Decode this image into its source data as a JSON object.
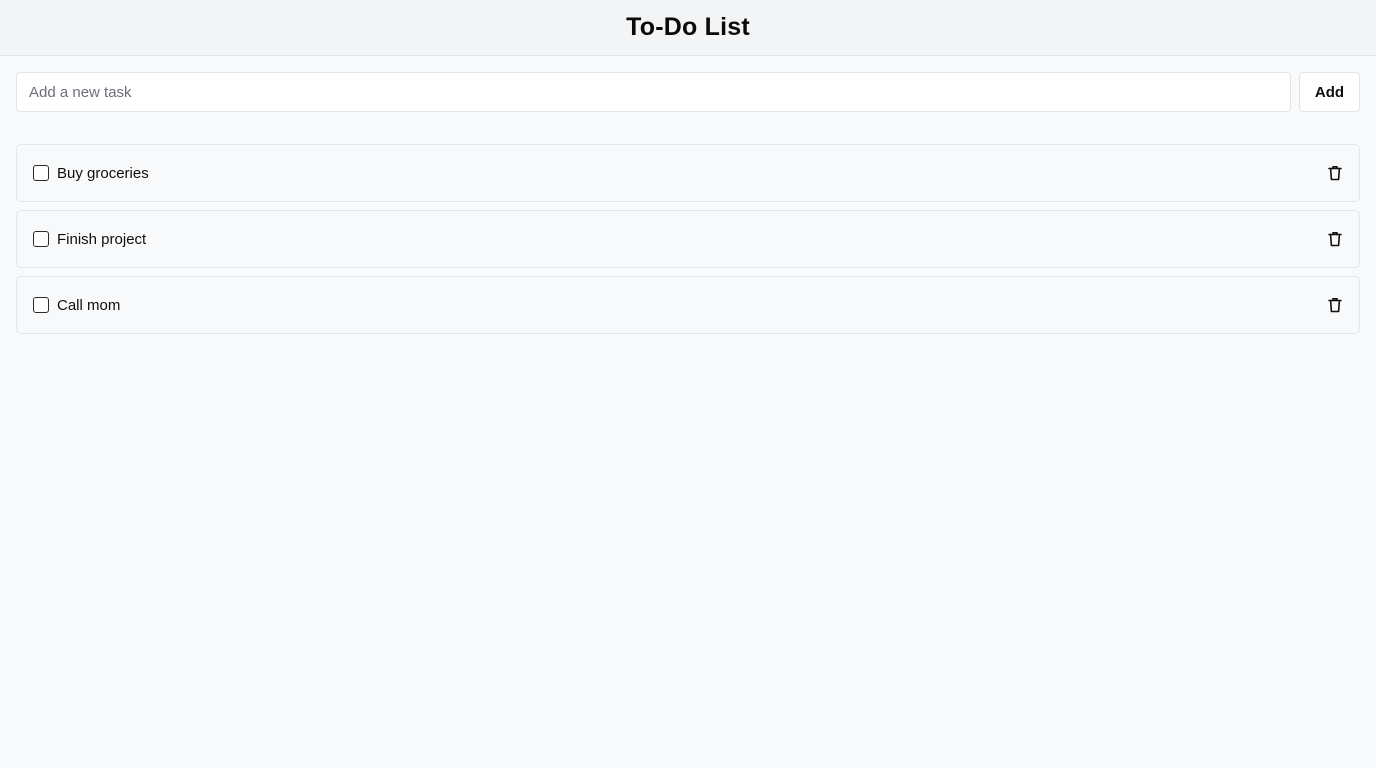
{
  "header": {
    "title": "To-Do List"
  },
  "add_task": {
    "placeholder": "Add a new task",
    "value": "",
    "button_label": "Add"
  },
  "tasks": [
    {
      "label": "Buy groceries",
      "completed": false,
      "delete_icon": "trash-icon"
    },
    {
      "label": "Finish project",
      "completed": false,
      "delete_icon": "trash-icon"
    },
    {
      "label": "Call mom",
      "completed": false,
      "delete_icon": "trash-icon"
    }
  ],
  "colors": {
    "background": "#f8fafc",
    "header_background": "#f3f4f6",
    "text": "#0f0f0f",
    "border": "#e4e6ea"
  }
}
